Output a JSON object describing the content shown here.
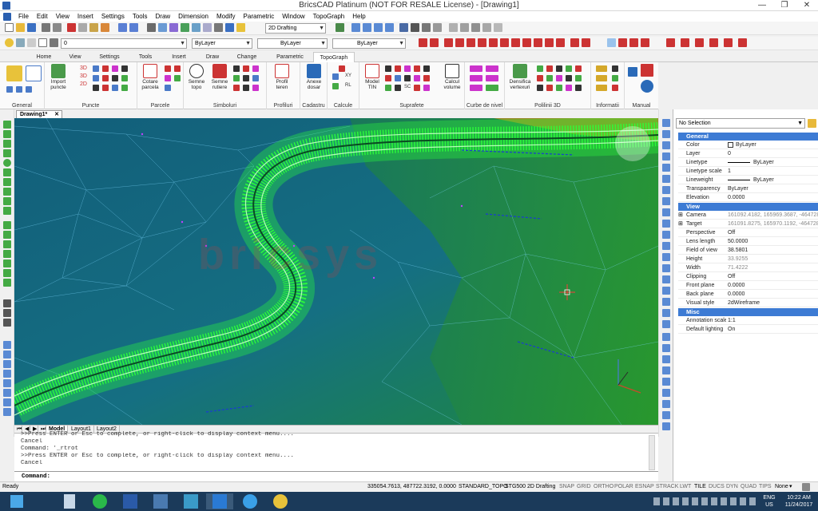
{
  "window": {
    "title": "BricsCAD Platinum (NOT FOR RESALE License) - [Drawing1]",
    "minimize": "—",
    "maximize": "❐",
    "close": "✕"
  },
  "menu": [
    "File",
    "Edit",
    "View",
    "Insert",
    "Settings",
    "Tools",
    "Draw",
    "Dimension",
    "Modify",
    "Parametric",
    "Window",
    "TopoGraph",
    "Help"
  ],
  "toolbar1": {
    "workspace": "2D Drafting"
  },
  "toolbar2": {
    "layer": "0",
    "color": "ByLayer",
    "linetype": "ByLayer",
    "lineweight": "ByLayer"
  },
  "ribbon_tabs": [
    "Home",
    "View",
    "Settings",
    "Tools",
    "Insert",
    "Draw",
    "Change",
    "Parametric",
    "TopoGraph"
  ],
  "ribbon_active_tab": "TopoGraph",
  "ribbon": {
    "groups": [
      "General",
      "Puncte",
      "Parcele",
      "Simboluri",
      "Profiluri",
      "Cadastru",
      "Calcule",
      "Suprafete",
      "Curbe de nivel",
      "Polilinii 3D",
      "Informatii",
      "Manual"
    ],
    "buttons": {
      "import_puncte": "Import puncte",
      "cotare_parcela": "Cotare parcela",
      "semne_topo": "Semne topo",
      "semne_rutiere": "Semne rutiere",
      "profil_teren": "Profil teren",
      "anexe_dosar": "Anexe dosar",
      "model_tin": "Model TIN",
      "calcul_volume": "Calcul volume",
      "densifica_vertexuri": "Densifica vertexuri"
    },
    "small_labels": {
      "p3d_a": "3D",
      "p3d_b": "3D",
      "p2d": "2D",
      "xy": "XY",
      "rl": "RL",
      "sc": "SC"
    }
  },
  "document_tab": "Drawing1*",
  "watermark": "bricsys",
  "layout_tabs": [
    "Model",
    "Layout1",
    "Layout2"
  ],
  "command_history": [
    ">>Press ENTER or Esc to complete, or right-click to display context menu....",
    "Cancel",
    "Command: '_rtrot",
    ">>Press ENTER or Esc to complete, or right-click to display context menu....",
    "Cancel"
  ],
  "command_prompt": "Command:",
  "properties": {
    "selection": "No Selection",
    "sections": {
      "general": "General",
      "view": "View",
      "misc": "Misc"
    },
    "general_rows": [
      {
        "key": "Color",
        "value": "ByLayer"
      },
      {
        "key": "Layer",
        "value": "0"
      },
      {
        "key": "Linetype",
        "value": "ByLayer"
      },
      {
        "key": "Linetype scale",
        "value": "1"
      },
      {
        "key": "Lineweight",
        "value": "ByLayer"
      },
      {
        "key": "Transparency",
        "value": "ByLayer"
      },
      {
        "key": "Elevation",
        "value": "0.0000"
      }
    ],
    "view_rows": [
      {
        "key": "Camera",
        "value": "161092.4182, 165969.3687, -464728."
      },
      {
        "key": "Target",
        "value": "161091.8275, 165970.1192, -464728."
      },
      {
        "key": "Perspective",
        "value": "Off"
      },
      {
        "key": "Lens length",
        "value": "50.0000"
      },
      {
        "key": "Field of view",
        "value": "38.5801"
      },
      {
        "key": "Height",
        "value": "33.9255"
      },
      {
        "key": "Width",
        "value": "71.4222"
      },
      {
        "key": "Clipping",
        "value": "Off"
      },
      {
        "key": "Front plane",
        "value": "0.0000"
      },
      {
        "key": "Back plane",
        "value": "0.0000"
      },
      {
        "key": "Visual style",
        "value": "2dWireframe"
      }
    ],
    "misc_rows": [
      {
        "key": "Annotation scale",
        "value": "1:1"
      },
      {
        "key": "Default lighting",
        "value": "On"
      }
    ]
  },
  "status": {
    "ready": "Ready",
    "coords": "335054.7613, 487722.3192, 0.0000",
    "textstyle": "STANDARD_TOPO",
    "dimstyle": "STG500",
    "workspace": "2D Drafting",
    "toggles": [
      "SNAP",
      "GRID",
      "ORTHO",
      "POLAR",
      "ESNAP",
      "STRACK",
      "LWT",
      "TILE",
      "DUCS",
      "DYN",
      "QUAD",
      "TIPS"
    ],
    "none": "None"
  },
  "taskbar": {
    "lang": "ENG",
    "region": "US",
    "time": "10:22 AM",
    "date": "11/24/2017"
  },
  "colors": {
    "terrain_dark": "#136a83",
    "terrain_green": "#1f8a3a",
    "mesh_bright": "#2cff3a",
    "section_blue": "#3d7bd4"
  }
}
